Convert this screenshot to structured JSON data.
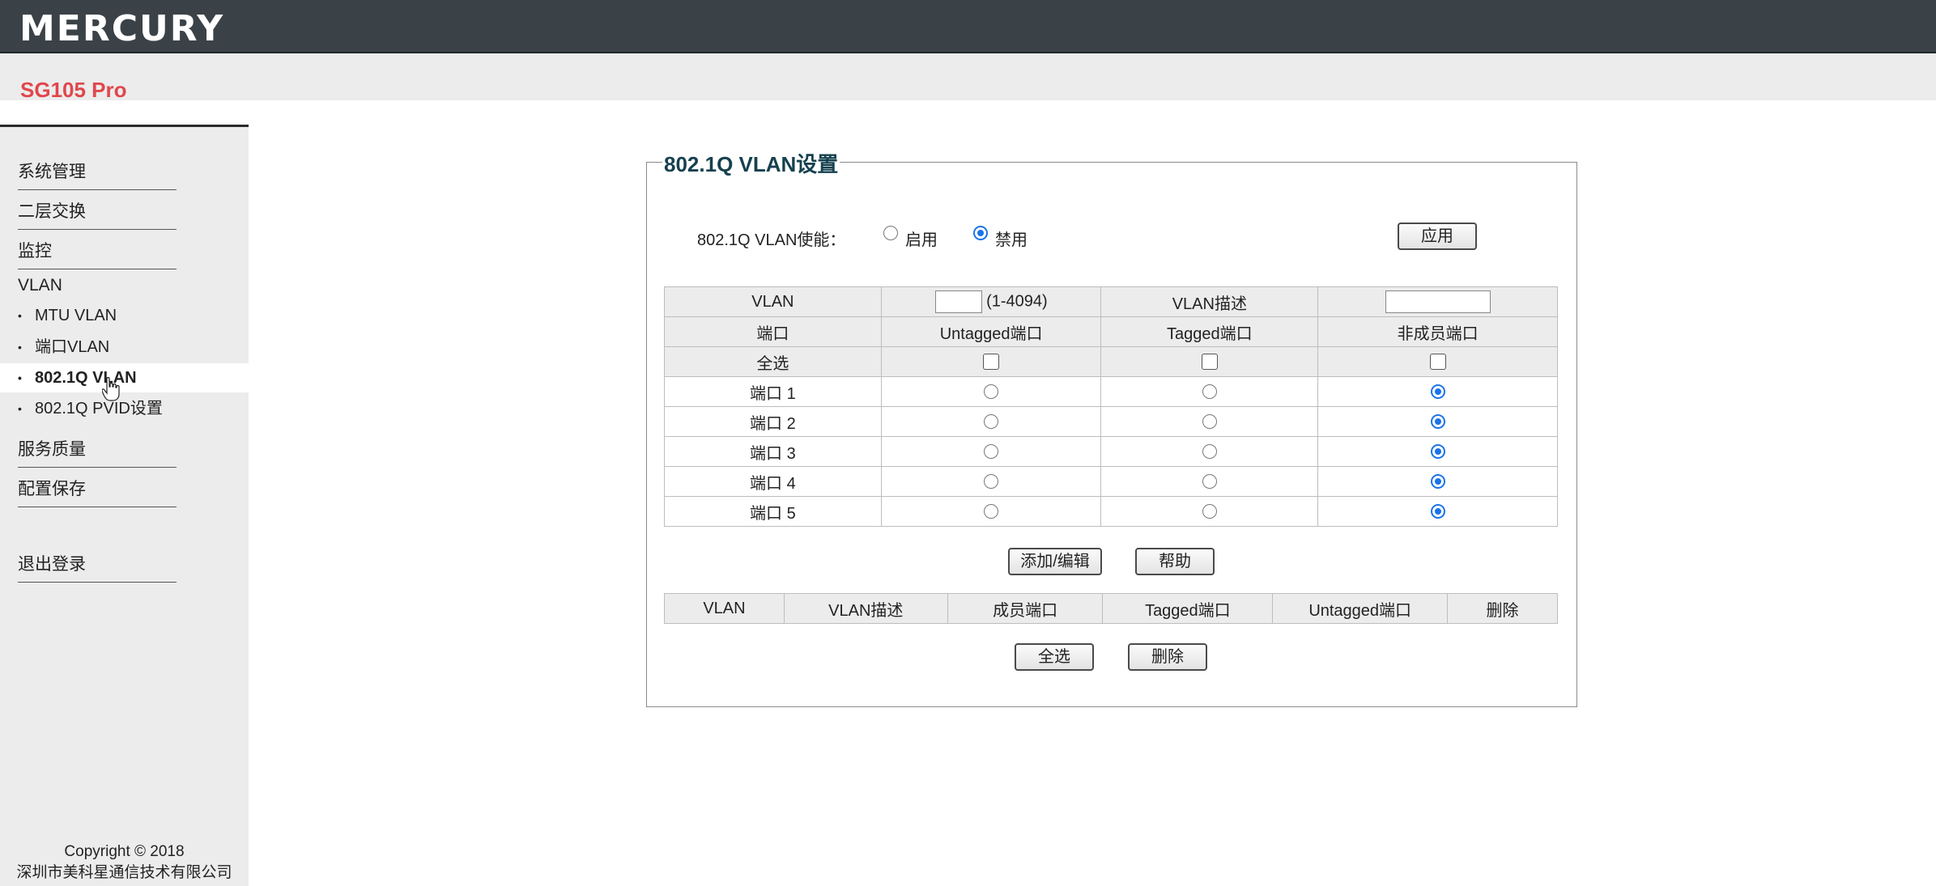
{
  "header": {
    "brand": "MERCURY",
    "model": "SG105 Pro"
  },
  "sidebar": {
    "items_top": [
      "系统管理",
      "二层交换",
      "监控"
    ],
    "vlan_head": "VLAN",
    "vlan_sub": [
      {
        "label": "MTU VLAN",
        "active": false
      },
      {
        "label": "端口VLAN",
        "active": false
      },
      {
        "label": "802.1Q VLAN",
        "active": true
      },
      {
        "label": "802.1Q PVID设置",
        "active": false
      }
    ],
    "items_bottom": [
      "服务质量",
      "配置保存"
    ],
    "logout": "退出登录",
    "copyright_line1": "Copyright © 2018",
    "copyright_line2": "深圳市美科星通信技术有限公司"
  },
  "panel": {
    "title": "802.1Q VLAN设置",
    "enable_label": "802.1Q VLAN使能：",
    "enable_options": [
      {
        "label": "启用",
        "selected": false
      },
      {
        "label": "禁用",
        "selected": true
      }
    ],
    "apply_button": "应用",
    "vlan_row": {
      "vlan_label": "VLAN",
      "range_hint": "(1-4094)",
      "desc_label": "VLAN描述",
      "vlan_value": "",
      "desc_value": ""
    },
    "port_headers": [
      "端口",
      "Untagged端口",
      "Tagged端口",
      "非成员端口"
    ],
    "select_all_label": "全选",
    "ports": [
      {
        "name": "端口 1",
        "mode": "non-member"
      },
      {
        "name": "端口 2",
        "mode": "non-member"
      },
      {
        "name": "端口 3",
        "mode": "non-member"
      },
      {
        "name": "端口 4",
        "mode": "non-member"
      },
      {
        "name": "端口 5",
        "mode": "non-member"
      }
    ],
    "add_edit_button": "添加/编辑",
    "help_button": "帮助",
    "list_headers": [
      "VLAN",
      "VLAN描述",
      "成员端口",
      "Tagged端口",
      "Untagged端口",
      "删除"
    ],
    "select_all_button": "全选",
    "delete_button": "删除"
  },
  "colors": {
    "header_bg": "#3b4247",
    "model_red": "#e0474c",
    "title_teal": "#16414f",
    "radio_blue": "#1a73e8"
  }
}
